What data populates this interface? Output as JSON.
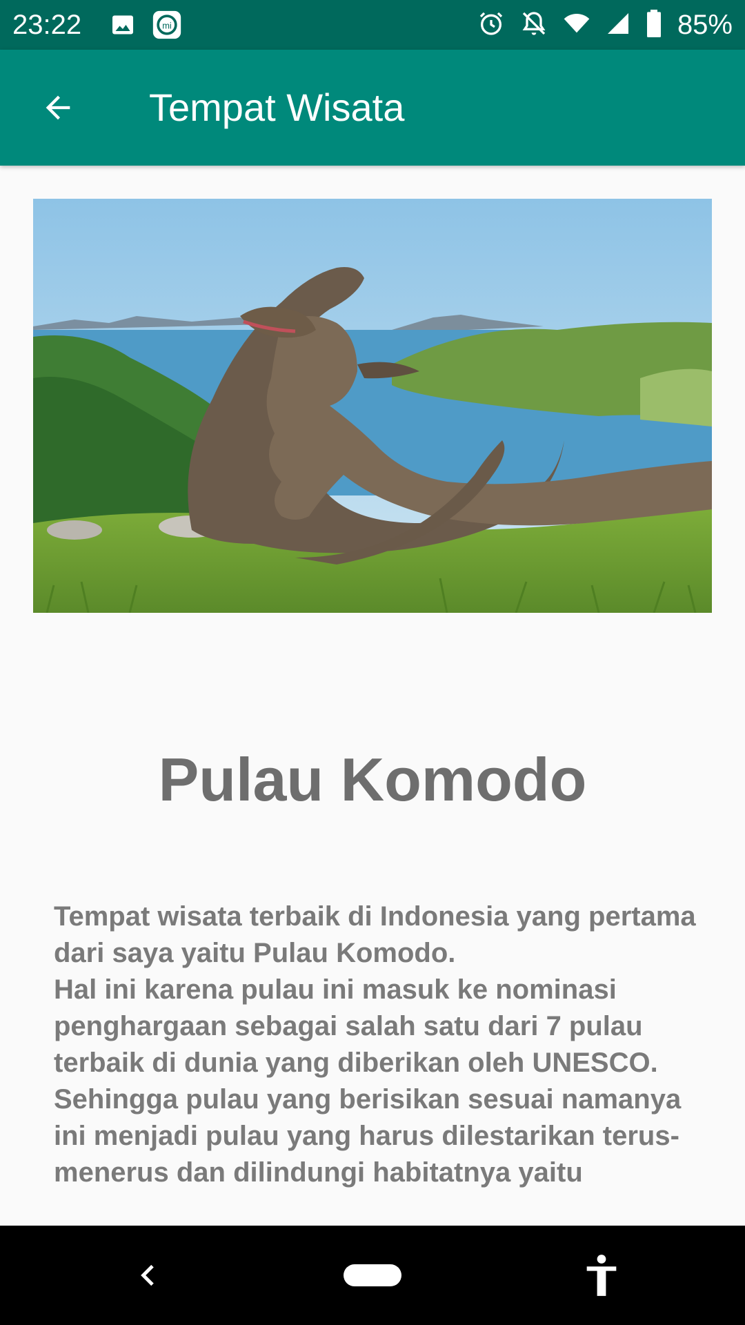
{
  "status_bar": {
    "time": "23:22",
    "battery": "85%",
    "icons": [
      "image-icon",
      "mi-icon",
      "alarm-icon",
      "notifications-off-icon",
      "wifi-icon",
      "signal-icon",
      "battery-icon"
    ]
  },
  "app_bar": {
    "title": "Tempat Wisata",
    "back_icon": "arrow-back-icon",
    "color": "#00897b",
    "status_color": "#00695c"
  },
  "place": {
    "image_icon": "komodo-photo",
    "title": "Pulau Komodo",
    "description": "Tempat wisata terbaik di Indonesia yang pertama dari saya yaitu Pulau Komodo.\nHal ini karena pulau ini masuk ke nominasi penghargaan sebagai salah satu dari 7 pulau terbaik di dunia yang diberikan oleh UNESCO. Sehingga pulau yang berisikan sesuai namanya ini menjadi pulau yang harus dilestarikan terus-menerus dan dilindungi habitatnya yaitu"
  },
  "nav_bar": {
    "icons": [
      "nav-back-icon",
      "nav-home-icon",
      "accessibility-icon"
    ]
  }
}
